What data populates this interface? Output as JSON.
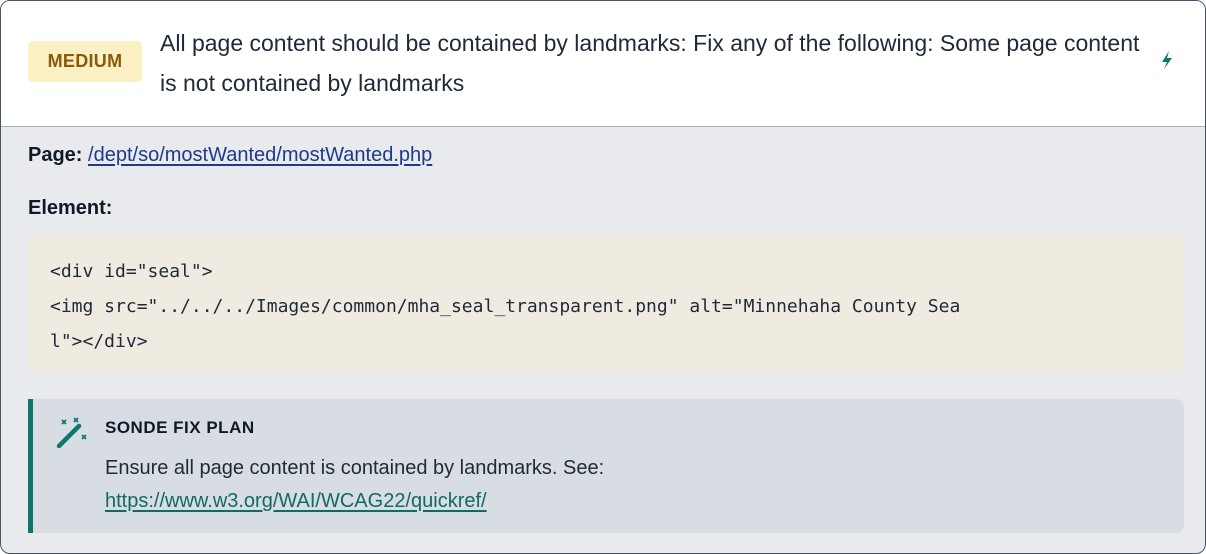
{
  "issue": {
    "severity": "MEDIUM",
    "title": "All page content should be contained by landmarks: Fix any of the following: Some page content is not contained by landmarks",
    "icon": "bolt-icon"
  },
  "details": {
    "page_label": "Page:",
    "page_url": "/dept/so/mostWanted/mostWanted.php",
    "element_label": "Element:",
    "element_code": "<div id=\"seal\">\n<img src=\"../../../Images/common/mha_seal_transparent.png\" alt=\"Minnehaha County Sea\nl\"></div>"
  },
  "fix_plan": {
    "icon": "magic-wand-icon",
    "heading": "SONDE FIX PLAN",
    "text": "Ensure all page content is contained by landmarks. See:",
    "link": "https://www.w3.org/WAI/WCAG22/quickref/"
  },
  "colors": {
    "severity_bg": "#fbf0c4",
    "severity_text": "#8a5a0c",
    "accent": "#0f766e",
    "link": "#1e3a8a"
  }
}
